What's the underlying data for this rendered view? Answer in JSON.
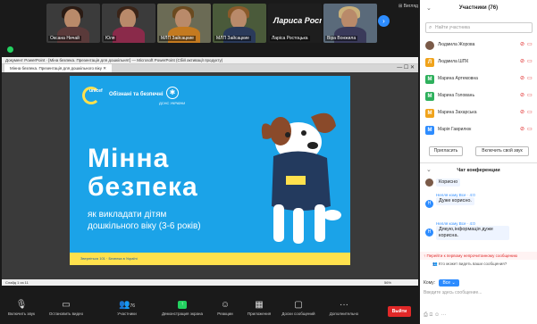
{
  "gallery": {
    "tiles": [
      "Оксана Ничай",
      "Юля",
      "МЛП Зайсацкие",
      "Лариса Ростоцька",
      "Ларіса Ростоцька",
      "Віра Вонжила"
    ],
    "view_label": "Вигляд"
  },
  "screen": {
    "app_title": "Документ PowerPoint · [Міна безпека. Презентація для дошкільнят] — Microsoft PowerPoint (Сбій активації продукту)",
    "tab_label": "Мінна безпека. Презентація для дошкільного віку",
    "window_controls": "— ☐ ✕",
    "status_left": "Слайд 1 из 11",
    "status_right": "56%",
    "slide": {
      "logo_brand": "unicef",
      "logo_text": "Обізнані та безпечні",
      "emblem_text": "ДСНС УКРАЇНИ",
      "title_line1": "Мінна",
      "title_line2": "безпека",
      "subtitle_line1": "як викладати дітям",
      "subtitle_line2": "дошкільного віку (3-6 років)",
      "footer_text": "Зверніться 101 · Безпека в Україні"
    },
    "colors": {
      "slide_bg": "#1ba3e8",
      "accent_yellow": "#ffe14d"
    }
  },
  "toolbar": {
    "items": [
      {
        "icon": "mic-muted-icon",
        "label": "Включить звук"
      },
      {
        "icon": "video-icon",
        "label": "Остановить видео"
      },
      {
        "icon": "participants-icon",
        "label": "Участники",
        "count": "76"
      },
      {
        "icon": "share-screen-icon",
        "label": "Демонстрация экрана"
      },
      {
        "icon": "reactions-icon",
        "label": "Реакции"
      },
      {
        "icon": "apps-icon",
        "label": "Приложения"
      },
      {
        "icon": "whiteboard-icon",
        "label": "Доски сообщений"
      },
      {
        "icon": "more-icon",
        "label": "Дополнительно"
      }
    ],
    "end_label": "Выйти"
  },
  "panel": {
    "title": "Участники (76)",
    "search_placeholder": "Найти участника",
    "participants": [
      {
        "initial": "",
        "name": "Людмила Жорова",
        "color": "#7a5a48"
      },
      {
        "initial": "Л",
        "name": "Людмила ШПК",
        "color": "#f0a31c"
      },
      {
        "initial": "М",
        "name": "Марина Артемовна",
        "color": "#2eb05c"
      },
      {
        "initial": "М",
        "name": "Марина Головань",
        "color": "#2eb05c"
      },
      {
        "initial": "М",
        "name": "Марина Захарська",
        "color": "#f0a31c"
      },
      {
        "initial": "М",
        "name": "Марія Гаврилюк",
        "color": "#2d8cff"
      }
    ],
    "invite_label": "Пригласить",
    "mute_own_label": "Включить свой звук",
    "chat_title": "Чат конференции",
    "messages": [
      {
        "meta": "",
        "initial": "",
        "text": "Корисно"
      },
      {
        "meta": "Нелля кому Все · 4:0",
        "initial": "Н",
        "text": "Дуже корисно."
      },
      {
        "meta": "Нелля кому Все · 4:0",
        "initial": "Н",
        "text": "Дякую,інформація дуже корисна."
      }
    ],
    "jump_label": "Перейти к первому непрочитанному сообщению",
    "who_can_see": "Кто может видеть ваши сообщения?",
    "to_label": "Кому:",
    "to_value": "Все",
    "input_placeholder": "Введите здесь сообщение..."
  }
}
